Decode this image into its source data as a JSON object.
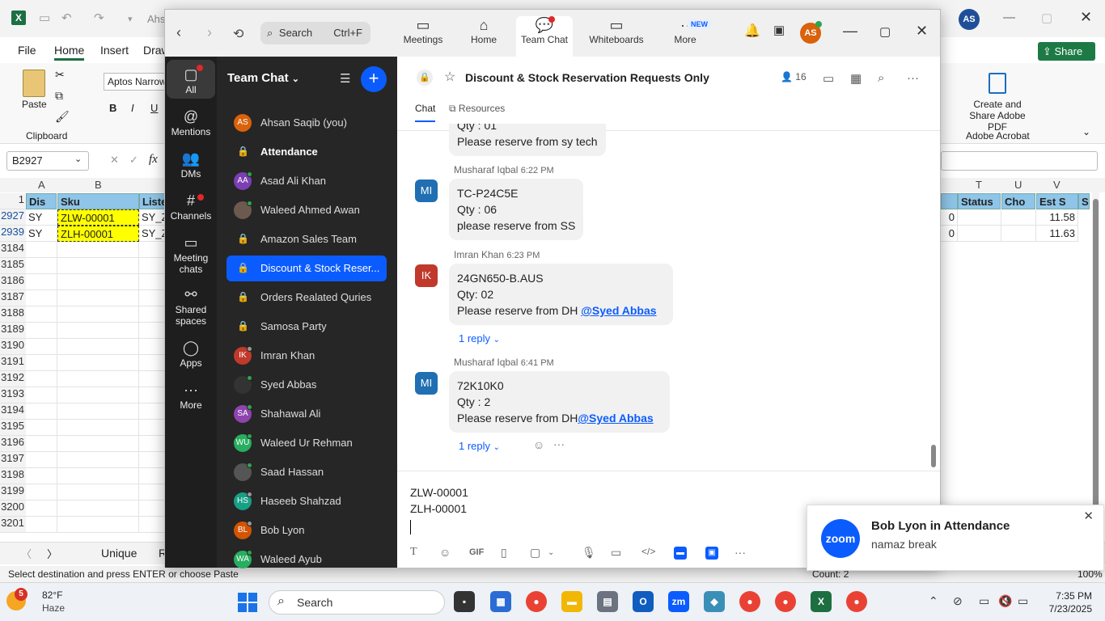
{
  "excel": {
    "title_partial": "Ahs",
    "tabs": [
      "File",
      "Home",
      "Insert",
      "Draw"
    ],
    "font_box": "Aptos Narrow",
    "clipboard_group": "Clipboard",
    "paste_label": "Paste",
    "namebox": "B2927",
    "fx": "fx",
    "share_label": "Share",
    "create_pdf_label": "Create and Share Adobe PDF",
    "acrobat_label": "Adobe Acrobat",
    "col_letters": [
      "A",
      "B",
      "T",
      "U",
      "V"
    ],
    "header_cells": [
      "Dis",
      "Sku",
      "Liste",
      "Status",
      "Cho",
      "Est S",
      "S"
    ],
    "rows": [
      {
        "num": "2927",
        "a": "SY",
        "b": "ZLW-00001",
        "c": "SY_Z",
        "t_left": "0",
        "v": "11.58"
      },
      {
        "num": "2939",
        "a": "SY",
        "b": "ZLH-00001",
        "c": "SY_Z",
        "t_left": "0",
        "v": "11.63"
      }
    ],
    "row_nums": [
      "3184",
      "3185",
      "3186",
      "3187",
      "3188",
      "3189",
      "3190",
      "3191",
      "3192",
      "3193",
      "3194",
      "3195",
      "3196",
      "3197",
      "3198",
      "3199",
      "3200",
      "3201"
    ],
    "header_row_num": "1",
    "sheet_tab": "Unique",
    "sheet_tab2": "R",
    "status_text": "Select destination and press ENTER or choose Paste",
    "count_text": "Count: 2",
    "zoom_pct": "100%"
  },
  "zoom": {
    "search_placeholder": "Search",
    "search_shortcut": "Ctrl+F",
    "nav_tabs": [
      {
        "label": "Meetings",
        "icon": "video-icon"
      },
      {
        "label": "Home",
        "icon": "home-icon"
      },
      {
        "label": "Team Chat",
        "icon": "chat-icon"
      },
      {
        "label": "Whiteboards",
        "icon": "whiteboard-icon"
      },
      {
        "label": "More",
        "icon": "more-icon"
      }
    ],
    "new_badge": "NEW",
    "user_initials": "AS",
    "rail": [
      {
        "label": "All",
        "icon": "chat-bubble-icon"
      },
      {
        "label": "Mentions",
        "icon": "at-icon"
      },
      {
        "label": "DMs",
        "icon": "people-icon"
      },
      {
        "label": "Channels",
        "icon": "hash-icon"
      },
      {
        "label": "Meeting chats",
        "icon": "calendar-icon"
      },
      {
        "label": "Shared spaces",
        "icon": "share-icon"
      },
      {
        "label": "Apps",
        "icon": "apps-icon"
      },
      {
        "label": "More",
        "icon": "ellipsis-icon"
      }
    ],
    "list_title": "Team Chat",
    "list_items": [
      {
        "name": "Ahsan Saqib (you)",
        "kind": "avatar",
        "initials": "AS",
        "color": "#d9620b",
        "presence": "none"
      },
      {
        "name": "Attendance",
        "kind": "lock",
        "bold": true
      },
      {
        "name": "Asad Ali Khan",
        "kind": "avatar",
        "initials": "AA",
        "color": "#7b3fb3",
        "presence": "on"
      },
      {
        "name": "Waleed Ahmed Awan",
        "kind": "avatar",
        "initials": "",
        "color": "#6d5a4e",
        "presence": "on"
      },
      {
        "name": "Amazon Sales Team",
        "kind": "lock"
      },
      {
        "name": "Discount & Stock Reser...",
        "kind": "lock",
        "selected": true
      },
      {
        "name": "Orders Realated Quries",
        "kind": "lock"
      },
      {
        "name": "Samosa Party",
        "kind": "lock"
      },
      {
        "name": "Imran Khan",
        "kind": "avatar",
        "initials": "IK",
        "color": "#c0392b",
        "presence": "off"
      },
      {
        "name": "Syed Abbas",
        "kind": "avatar",
        "initials": "",
        "color": "#333",
        "presence": "on"
      },
      {
        "name": "Shahawal Ali",
        "kind": "avatar",
        "initials": "SA",
        "color": "#8e44ad",
        "presence": "on"
      },
      {
        "name": "Waleed Ur Rehman",
        "kind": "avatar",
        "initials": "WU",
        "color": "#27ae60",
        "presence": "on"
      },
      {
        "name": "Saad Hassan",
        "kind": "avatar",
        "initials": "",
        "color": "#555",
        "presence": "on"
      },
      {
        "name": "Haseeb Shahzad",
        "kind": "avatar",
        "initials": "HS",
        "color": "#16a085",
        "presence": "off"
      },
      {
        "name": "Bob Lyon",
        "kind": "avatar",
        "initials": "BL",
        "color": "#d35400",
        "presence": "off"
      },
      {
        "name": "Waleed Ayub",
        "kind": "avatar",
        "initials": "WA",
        "color": "#27ae60",
        "presence": "on"
      }
    ],
    "channel_title": "Discount & Stock Reservation Requests Only",
    "member_count": "16",
    "chat_tabs": [
      "Chat",
      "Resources"
    ],
    "messages": [
      {
        "partial": true,
        "lines": [
          "Qty : 01",
          "Please reserve from sy tech"
        ]
      },
      {
        "sender": "Musharaf Iqbal",
        "time": "6:22 PM",
        "initials": "MI",
        "color": "#1f6fb2",
        "lines": [
          "TC-P24C5E",
          "Qty : 06",
          "please reserve from SS"
        ]
      },
      {
        "sender": "Imran Khan",
        "time": "6:23 PM",
        "initials": "IK",
        "color": "#c0392b",
        "lines": [
          "24GN650-B.AUS",
          "Qty: 02",
          "Please reserve from DH "
        ],
        "mention": "@Syed Abbas",
        "reply": "1 reply"
      },
      {
        "sender": "Musharaf Iqbal",
        "time": "6:41 PM",
        "initials": "MI",
        "color": "#1f6fb2",
        "lines": [
          "72K10K0",
          "Qty : 2",
          "Please reserve from DH"
        ],
        "mention": "@Syed Abbas",
        "reply": "1 reply"
      }
    ],
    "compose_lines": [
      "ZLW-00001",
      "ZLH-00001"
    ],
    "toolbar_gif": "GIF"
  },
  "notification": {
    "logo": "zoom",
    "title": "Bob Lyon in Attendance",
    "body": "namaz break"
  },
  "taskbar": {
    "temp": "82°F",
    "condition": "Haze",
    "weather_badge": "5",
    "search": "Search",
    "time": "7:35 PM",
    "date": "7/23/2025"
  }
}
